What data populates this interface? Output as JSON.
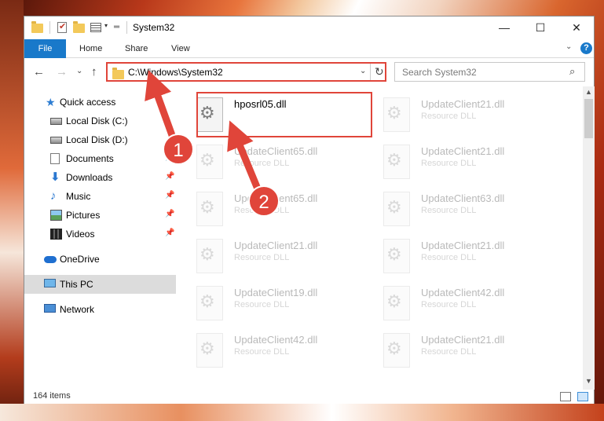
{
  "window": {
    "title": "System32",
    "controls": {
      "minimize": "—",
      "maximize": "☐",
      "close": "✕"
    }
  },
  "ribbon": {
    "tabs": [
      "File",
      "Home",
      "Share",
      "View"
    ],
    "help": "?"
  },
  "address": {
    "path": "C:\\Windows\\System32"
  },
  "search": {
    "placeholder": "Search System32"
  },
  "navpane": {
    "items": [
      {
        "label": "Quick access",
        "icon": "star-icon"
      },
      {
        "label": "Local Disk (C:)",
        "icon": "disk-icon"
      },
      {
        "label": "Local Disk (D:)",
        "icon": "disk-icon"
      },
      {
        "label": "Documents",
        "icon": "documents-icon"
      },
      {
        "label": "Downloads",
        "icon": "download-icon"
      },
      {
        "label": "Music",
        "icon": "music-icon"
      },
      {
        "label": "Pictures",
        "icon": "pictures-icon"
      },
      {
        "label": "Videos",
        "icon": "videos-icon"
      },
      {
        "label": "OneDrive",
        "icon": "cloud-icon"
      },
      {
        "label": "This PC",
        "icon": "computer-icon"
      },
      {
        "label": "Network",
        "icon": "network-icon"
      }
    ]
  },
  "files": [
    {
      "name": "hposrl05.dll",
      "type": ""
    },
    {
      "name": "UpdateClient21.dll",
      "type": "Resource DLL"
    },
    {
      "name": "UpdateClient65.dll",
      "type": "Resource DLL"
    },
    {
      "name": "UpdateClient21.dll",
      "type": "Resource DLL"
    },
    {
      "name": "UpdateClient65.dll",
      "type": "Resource DLL"
    },
    {
      "name": "UpdateClient63.dll",
      "type": "Resource DLL"
    },
    {
      "name": "UpdateClient21.dll",
      "type": "Resource DLL"
    },
    {
      "name": "UpdateClient21.dll",
      "type": "Resource DLL"
    },
    {
      "name": "UpdateClient19.dll",
      "type": "Resource DLL"
    },
    {
      "name": "UpdateClient42.dll",
      "type": "Resource DLL"
    },
    {
      "name": "UpdateClient42.dll",
      "type": "Resource DLL"
    },
    {
      "name": "UpdateClient21.dll",
      "type": "Resource DLL"
    }
  ],
  "status": {
    "item_count": "164 items"
  },
  "annotations": {
    "step1": "1",
    "step2": "2",
    "color": "#e0453a"
  }
}
